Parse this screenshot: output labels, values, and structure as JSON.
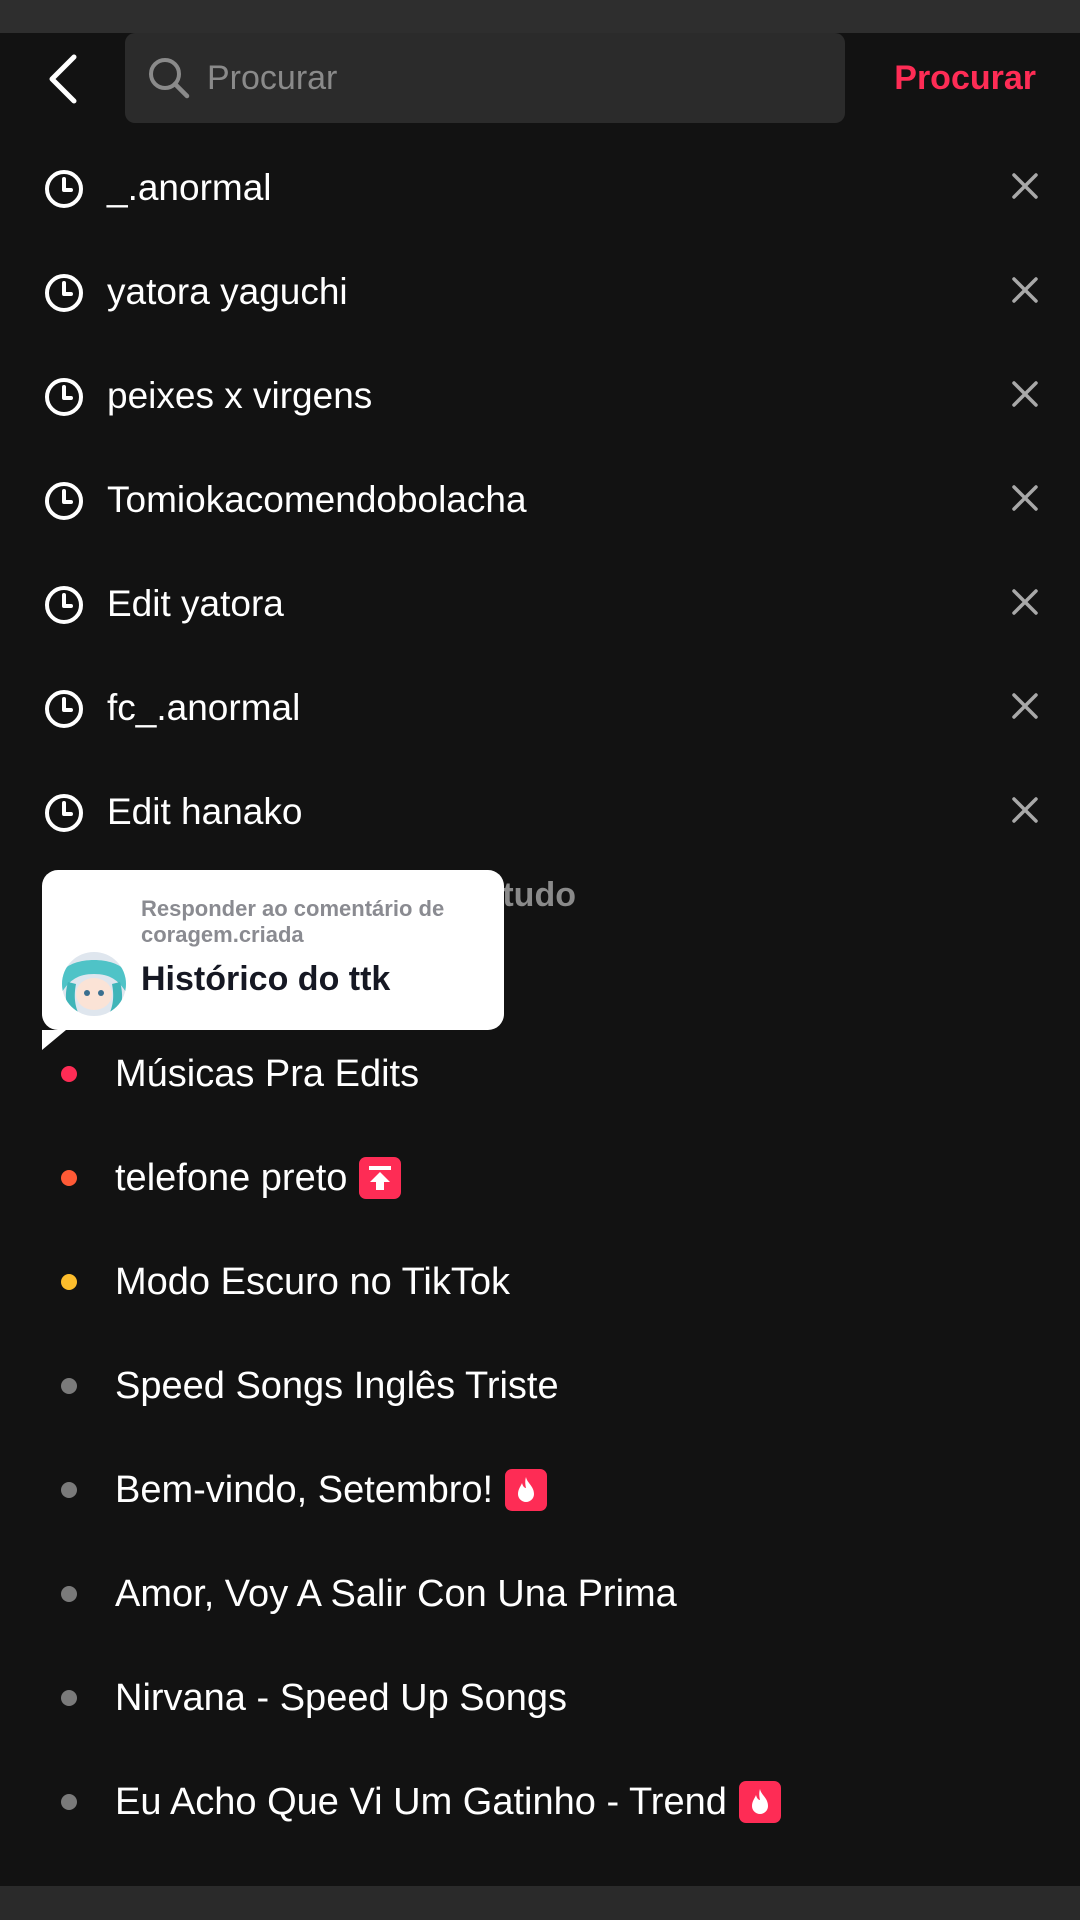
{
  "header": {
    "search_placeholder": "Procurar",
    "search_button": "Procurar"
  },
  "history": [
    {
      "text": "_.anormal"
    },
    {
      "text": "yatora yaguchi"
    },
    {
      "text": "peixes x virgens"
    },
    {
      "text": "Tomiokacomendobolacha"
    },
    {
      "text": "Edit yatora"
    },
    {
      "text": "fc_.anormal"
    },
    {
      "text": "Edit hanako"
    }
  ],
  "clear_all_partial": "par tudo",
  "tooltip": {
    "subtitle": "Responder ao comentário de coragem.criada",
    "title": "Histórico do ttk"
  },
  "suggestions": [
    {
      "text": "Músicas Pra Edits",
      "dot_color": "#fe2c55",
      "badge": null
    },
    {
      "text": "telefone preto",
      "dot_color": "#ff5a36",
      "badge": "trending-up-icon"
    },
    {
      "text": "Modo Escuro no TikTok",
      "dot_color": "#fcbd2c",
      "badge": null
    },
    {
      "text": "Speed Songs Inglês Triste",
      "dot_color": "#7a7a7a",
      "badge": null
    },
    {
      "text": "Bem-vindo, Setembro!",
      "dot_color": "#7a7a7a",
      "badge": "hot-flame-icon"
    },
    {
      "text": "Amor, Voy A Salir Con Una Prima",
      "dot_color": "#7a7a7a",
      "badge": null
    },
    {
      "text": "Nirvana - Speed Up Songs",
      "dot_color": "#7a7a7a",
      "badge": null
    },
    {
      "text": "Eu Acho Que Vi Um Gatinho - Trend",
      "dot_color": "#7a7a7a",
      "badge": "hot-flame-icon"
    }
  ],
  "colors": {
    "accent": "#fe2c55",
    "background": "#121212",
    "search_bg": "#2b2b2b"
  }
}
